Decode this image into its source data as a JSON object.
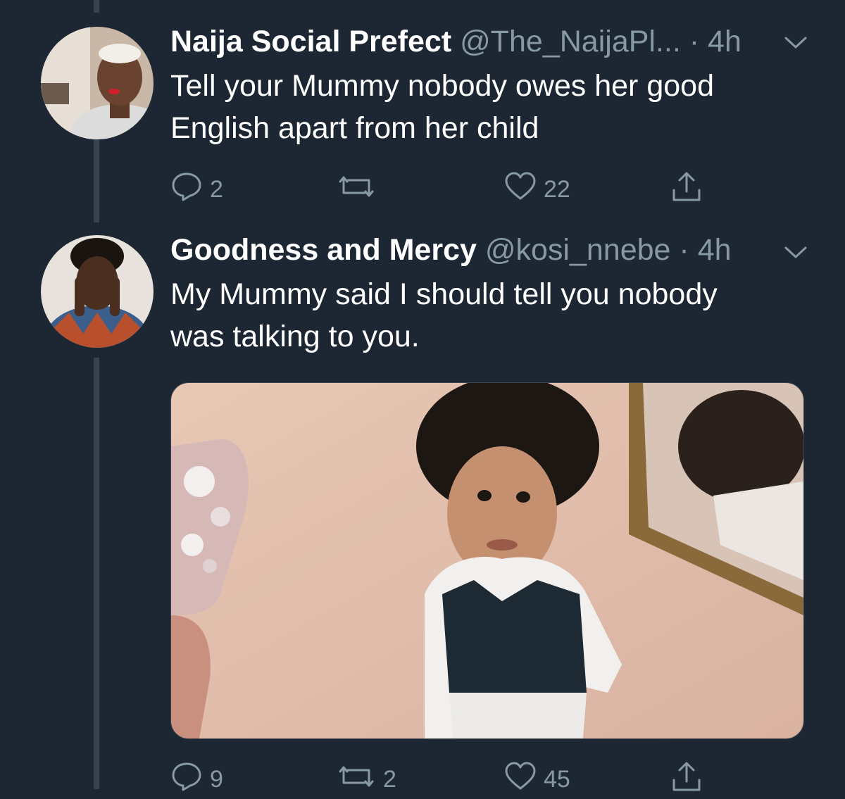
{
  "colors": {
    "background": "#1c2733",
    "text_primary": "#ffffff",
    "text_secondary": "#8899a6",
    "thread_line": "#38444d"
  },
  "tweets": [
    {
      "name": "Naija Social Prefect",
      "handle": "@The_NaijaPl...",
      "time": "· 4h",
      "text_line1": "Tell your Mummy nobody owes her good",
      "text_line2": "English apart from her child",
      "actions": {
        "reply_icon": "reply-icon",
        "reply_count": "2",
        "retweet_icon": "retweet-icon",
        "retweet_count": "",
        "like_icon": "heart-icon",
        "like_count": "22",
        "share_icon": "share-icon"
      }
    },
    {
      "name": "Goodness and Mercy",
      "handle": "@kosi_nnebe",
      "time": "· 4h",
      "text_line1": "My Mummy said I should tell you nobody",
      "text_line2": "was talking to you.",
      "actions": {
        "reply_icon": "reply-icon",
        "reply_count": "9",
        "retweet_icon": "retweet-icon",
        "retweet_count": "2",
        "like_icon": "heart-icon",
        "like_count": "45",
        "share_icon": "share-icon"
      }
    }
  ]
}
